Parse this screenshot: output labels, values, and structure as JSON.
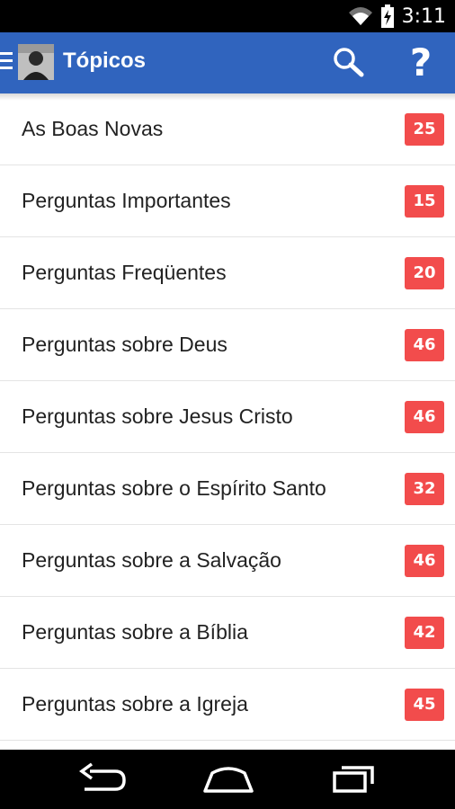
{
  "status": {
    "time": "3:11",
    "icons": [
      "wifi-icon",
      "battery-charging-icon"
    ]
  },
  "appbar": {
    "title": "Tópicos",
    "color": "#3064be",
    "icons": [
      "menu-icon",
      "avatar",
      "search-icon",
      "help-icon"
    ],
    "help_label": "?"
  },
  "topics": [
    {
      "label": "As Boas Novas",
      "count": "25"
    },
    {
      "label": "Perguntas Importantes",
      "count": "15"
    },
    {
      "label": "Perguntas Freqüentes",
      "count": "20"
    },
    {
      "label": "Perguntas sobre Deus",
      "count": "46"
    },
    {
      "label": "Perguntas sobre Jesus Cristo",
      "count": "46"
    },
    {
      "label": "Perguntas sobre o Espírito Santo",
      "count": "32"
    },
    {
      "label": "Perguntas sobre a Salvação",
      "count": "46"
    },
    {
      "label": "Perguntas sobre a Bíblia",
      "count": "42"
    },
    {
      "label": "Perguntas sobre a Igreja",
      "count": "45"
    }
  ],
  "badge_color": "#f24c4c",
  "navbar": {
    "icons": [
      "back-icon",
      "home-icon",
      "recents-icon"
    ]
  }
}
